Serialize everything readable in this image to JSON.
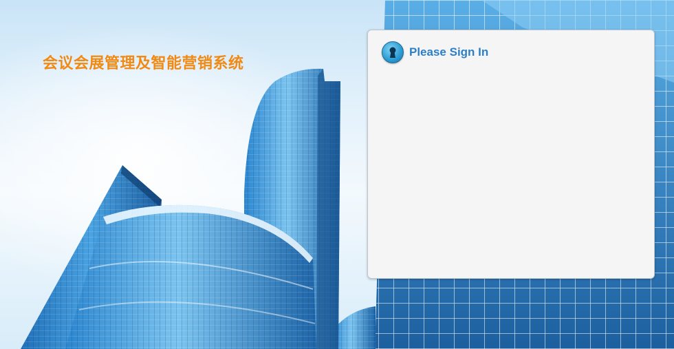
{
  "app": {
    "title": "会议会展管理及智能营销系统"
  },
  "login": {
    "heading": "Please Sign In",
    "icon": "keyhole-icon"
  },
  "colors": {
    "title_orange": "#f08a14",
    "heading_blue": "#2c7fc6",
    "panel_bg": "#f5f5f5"
  }
}
